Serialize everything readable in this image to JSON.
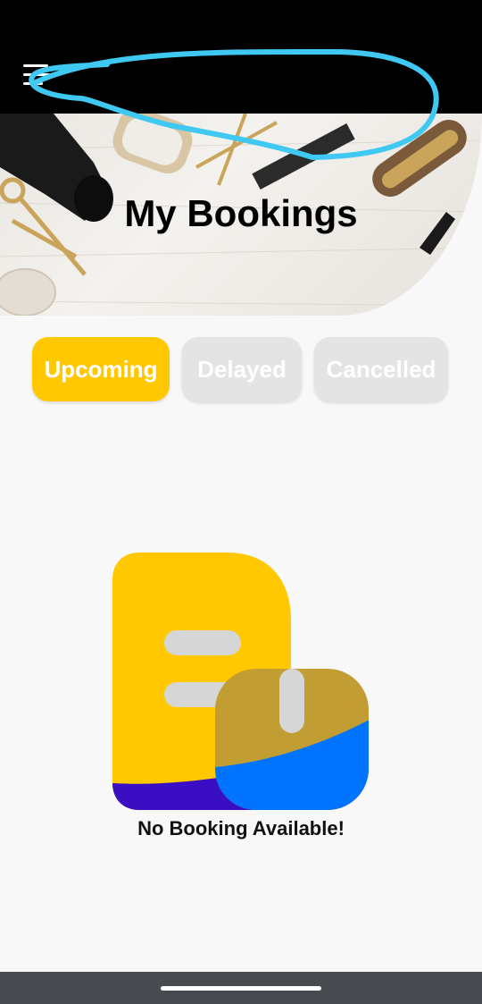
{
  "header": {
    "title": "My Bookings",
    "menu_icon": "hamburger-menu-icon"
  },
  "tabs": [
    {
      "label": "Upcoming",
      "active": true
    },
    {
      "label": "Delayed",
      "active": false
    },
    {
      "label": "Cancelled",
      "active": false
    }
  ],
  "empty_state": {
    "message": "No Booking Available!",
    "icon": "empty-bookings-illustration-icon"
  },
  "colors": {
    "accent": "#ffc800",
    "inactive_tab": "#e4e4e4",
    "annotation": "#3ec8f2",
    "illustration_blue": "#0074ff",
    "illustration_purple": "#3a0ec2",
    "illustration_gold": "#c29d33"
  }
}
